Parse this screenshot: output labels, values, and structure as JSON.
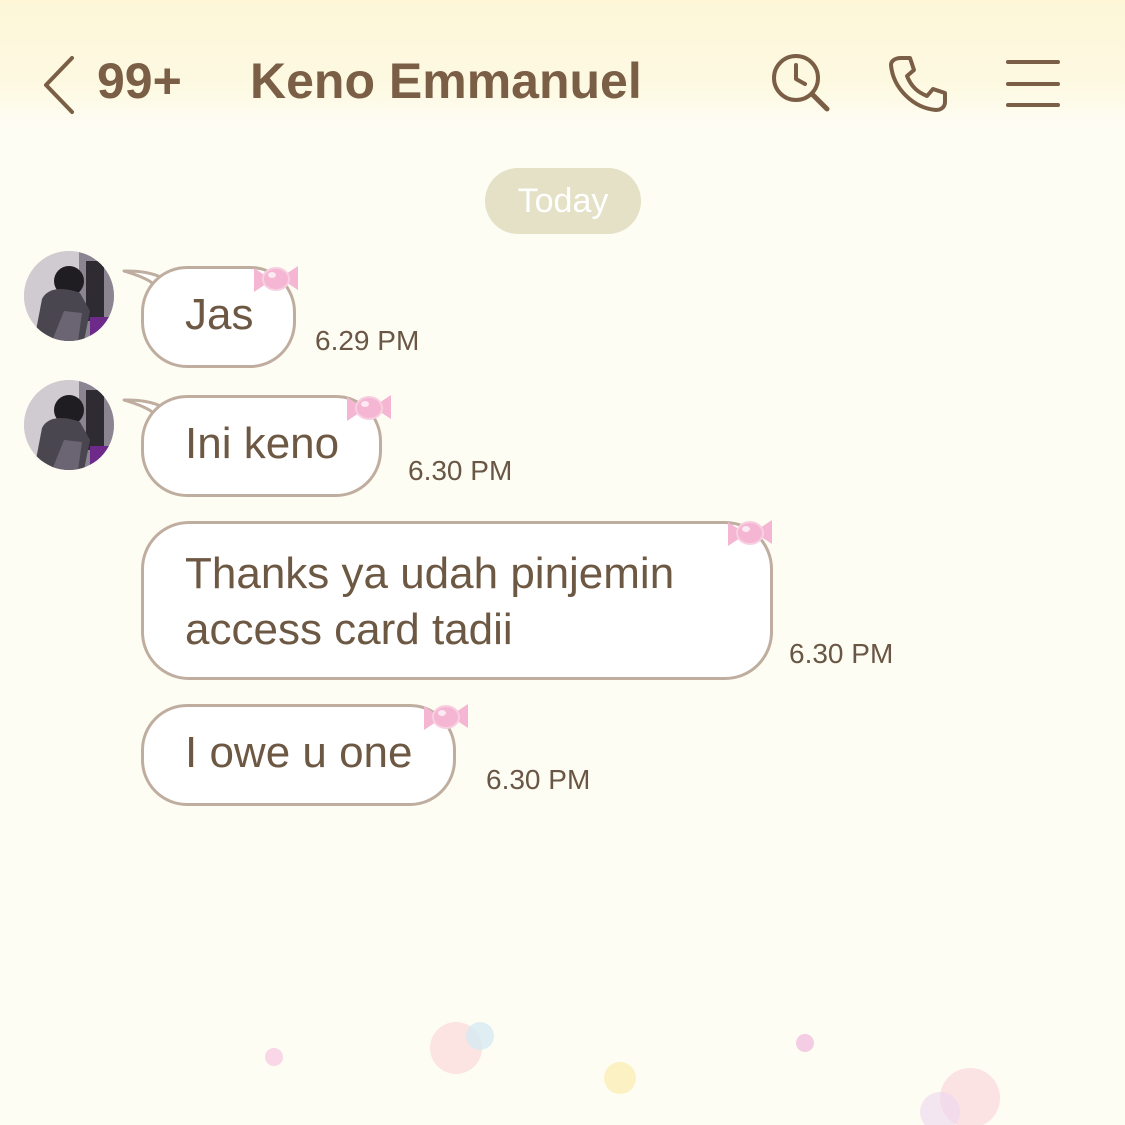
{
  "header": {
    "back_icon": "chevron-left-icon",
    "unread_count": "99+",
    "contact_name": "Keno Emmanuel",
    "icons": [
      "search-clock-icon",
      "phone-icon",
      "menu-icon"
    ]
  },
  "date_separator": "Today",
  "messages": [
    {
      "text": "Jas",
      "time": "6.29 PM",
      "show_avatar": true
    },
    {
      "text": "Ini keno",
      "time": "6.30 PM",
      "show_avatar": true
    },
    {
      "text": "Thanks ya udah pinjemin access card tadii",
      "line1": "Thanks ya udah pinjemin",
      "line2": "access card tadii",
      "time": "6.30 PM",
      "show_avatar": false
    },
    {
      "text": "I owe u one",
      "time": "6.30 PM",
      "show_avatar": false
    }
  ],
  "colors": {
    "accent_text": "#7a5e45",
    "bubble_border": "#bfae9f",
    "date_pill": "#e4e1c6",
    "background": "#fefdf4",
    "candy": "#f4b6d2"
  }
}
